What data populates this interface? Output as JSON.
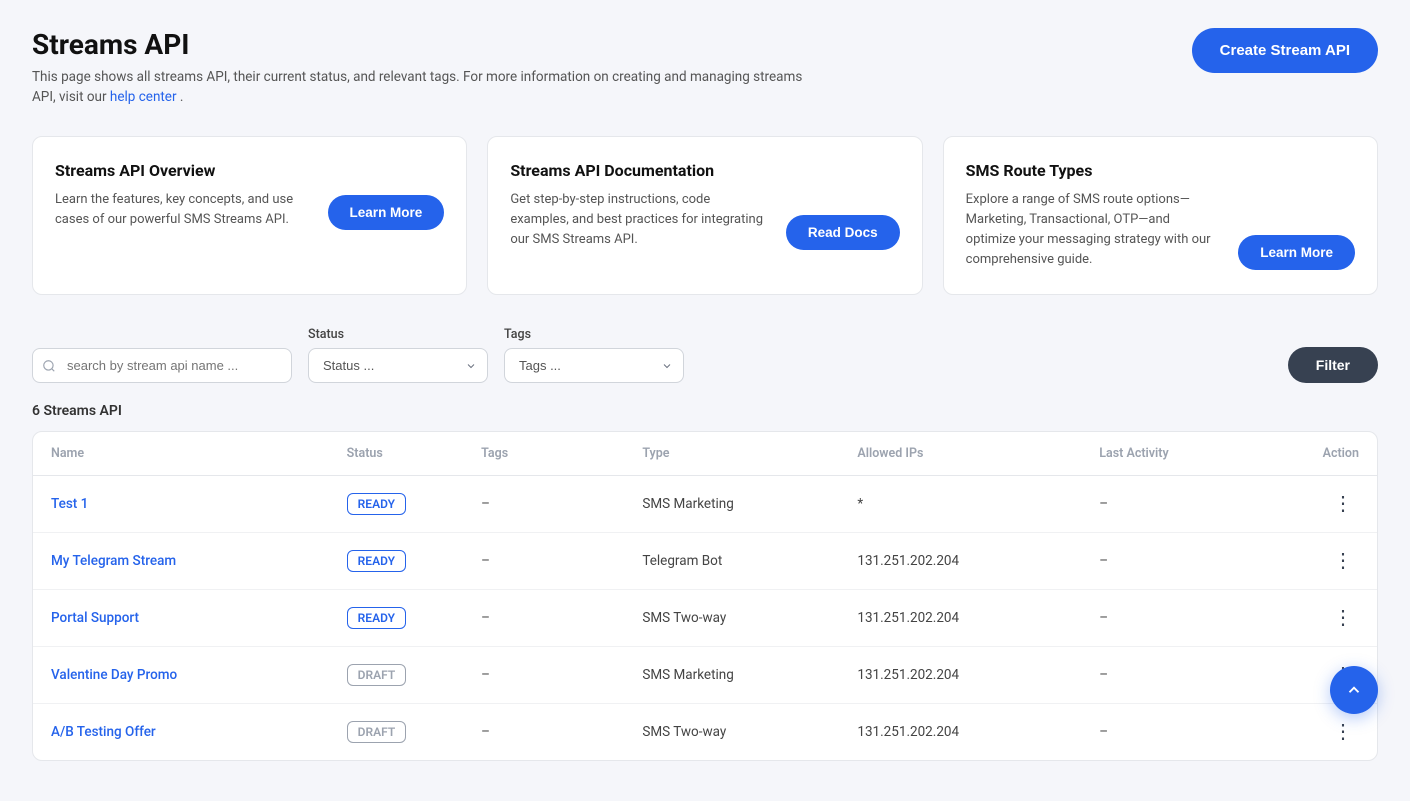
{
  "page": {
    "title": "Streams API",
    "subtitle": "This page shows all streams API, their current status, and relevant tags. For more information on creating and managing streams API, visit our ",
    "subtitle_link_text": "help center",
    "subtitle_end": ".",
    "create_btn_label": "Create Stream API"
  },
  "info_cards": [
    {
      "id": "overview",
      "title": "Streams API Overview",
      "text": "Learn the features, key concepts, and use cases of our powerful SMS Streams API.",
      "button_label": "Learn More"
    },
    {
      "id": "documentation",
      "title": "Streams API Documentation",
      "text": "Get step-by-step instructions, code examples, and best practices for integrating our SMS Streams API.",
      "button_label": "Read Docs"
    },
    {
      "id": "sms-route",
      "title": "SMS Route Types",
      "text": "Explore a range of SMS route options— Marketing, Transactional, OTP—and optimize your messaging strategy with our comprehensive guide.",
      "button_label": "Learn More"
    }
  ],
  "filters": {
    "search_placeholder": "search by stream api name ...",
    "status_label": "Status",
    "status_placeholder": "Status ...",
    "tags_label": "Tags",
    "tags_placeholder": "Tags ...",
    "filter_btn_label": "Filter"
  },
  "table": {
    "count_label": "6 Streams API",
    "columns": [
      "Name",
      "Status",
      "Tags",
      "Type",
      "Allowed IPs",
      "Last Activity",
      "Action"
    ],
    "rows": [
      {
        "name": "Test 1",
        "status": "READY",
        "status_type": "ready",
        "tags": "–",
        "type": "SMS Marketing",
        "allowed_ips": "*",
        "last_activity": "–"
      },
      {
        "name": "My Telegram Stream",
        "status": "READY",
        "status_type": "ready",
        "tags": "–",
        "type": "Telegram Bot",
        "allowed_ips": "131.251.202.204",
        "last_activity": "–"
      },
      {
        "name": "Portal Support",
        "status": "READY",
        "status_type": "ready",
        "tags": "–",
        "type": "SMS Two-way",
        "allowed_ips": "131.251.202.204",
        "last_activity": "–"
      },
      {
        "name": "Valentine Day Promo",
        "status": "DRAFT",
        "status_type": "draft",
        "tags": "–",
        "type": "SMS Marketing",
        "allowed_ips": "131.251.202.204",
        "last_activity": "–"
      },
      {
        "name": "A/B Testing Offer",
        "status": "DRAFT",
        "status_type": "draft",
        "tags": "–",
        "type": "SMS Two-way",
        "allowed_ips": "131.251.202.204",
        "last_activity": "–"
      }
    ]
  },
  "fab": {
    "icon": "▲"
  }
}
